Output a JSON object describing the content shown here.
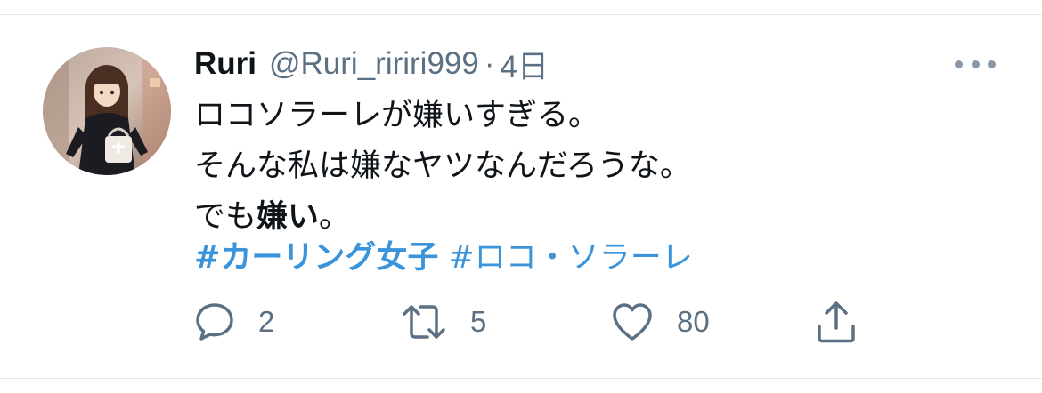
{
  "tweet": {
    "display_name": "Ruri",
    "handle": "@Ruri_ririri999",
    "separator": "·",
    "time": "4日",
    "lines": [
      "ロコソラーレが嫌いすぎる。",
      "そんな私は嫌なヤツなんだろうな。"
    ],
    "line3_prefix": "でも",
    "line3_bold": "嫌い",
    "line3_suffix": "。",
    "hashtags": [
      "#カーリング女子",
      "#ロコ・ソラーレ"
    ],
    "reply_count": "2",
    "retweet_count": "5",
    "like_count": "80"
  },
  "icons": {
    "avatar": "profile-photo-doll",
    "more": "more-horizontal-icon",
    "reply": "reply-icon",
    "retweet": "retweet-icon",
    "like": "heart-icon",
    "share": "share-icon"
  },
  "colors": {
    "link": "#3b94d9",
    "secondary_text": "#5b7083",
    "primary_text": "#0f1419"
  }
}
